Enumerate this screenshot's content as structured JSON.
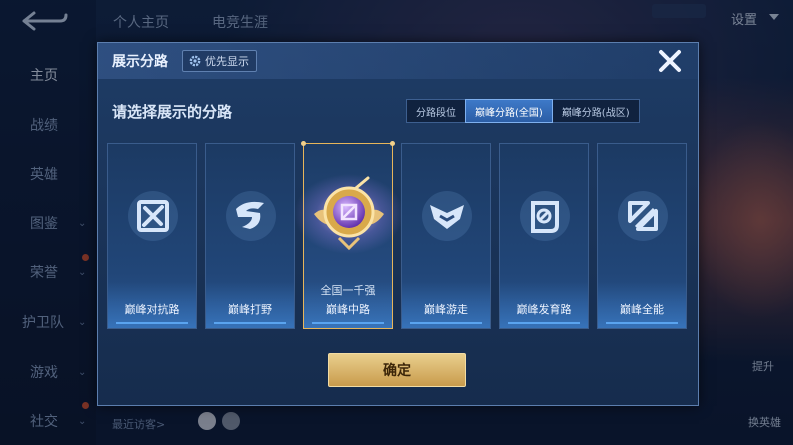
{
  "background": {
    "top_tabs": [
      "个人主页",
      "电竞生涯"
    ],
    "settings_label": "设置",
    "nav_items": [
      {
        "label": "主页",
        "active": true,
        "has_chevron": false
      },
      {
        "label": "战绩",
        "active": false,
        "has_chevron": false
      },
      {
        "label": "英雄",
        "active": false,
        "has_chevron": false
      },
      {
        "label": "图鉴",
        "active": false,
        "has_chevron": true
      },
      {
        "label": "荣誉",
        "active": false,
        "has_chevron": true
      },
      {
        "label": "护卫队",
        "active": false,
        "has_chevron": true
      },
      {
        "label": "游戏",
        "active": false,
        "has_chevron": true
      },
      {
        "label": "社交",
        "active": false,
        "has_chevron": true
      }
    ],
    "recent_visitors_label": "最近访客>",
    "change_hero_label": "换英雄",
    "upgrade_label": "提升"
  },
  "dialog": {
    "title": "展示分路",
    "priority_button": "优先显示",
    "prompt": "请选择展示的分路",
    "segments": [
      {
        "label": "分路段位",
        "active": false
      },
      {
        "label": "巅峰分路(全国)",
        "active": true
      },
      {
        "label": "巅峰分路(战区)",
        "active": false
      }
    ],
    "lanes": [
      {
        "label": "巅峰对抗路",
        "icon": "clash-lane-icon",
        "selected": false
      },
      {
        "label": "巅峰打野",
        "icon": "jungle-icon",
        "selected": false
      },
      {
        "label": "巅峰中路",
        "icon": "mid-lane-medal-icon",
        "selected": true,
        "subtitle": "全国一千强"
      },
      {
        "label": "巅峰游走",
        "icon": "roam-icon",
        "selected": false
      },
      {
        "label": "巅峰发育路",
        "icon": "farm-lane-icon",
        "selected": false
      },
      {
        "label": "巅峰全能",
        "icon": "all-round-icon",
        "selected": false
      }
    ],
    "confirm_button": "确定"
  },
  "colors": {
    "accent_blue": "#3d79c8",
    "gold": "#e7b55a",
    "dialog_bg": "#1e3c66"
  }
}
